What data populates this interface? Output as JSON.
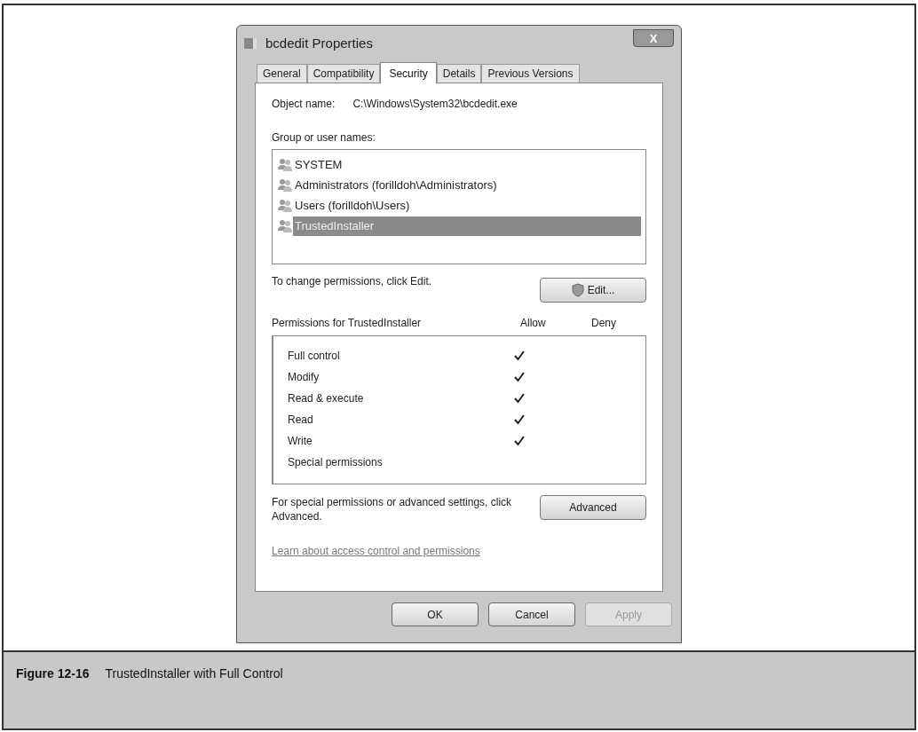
{
  "window": {
    "title": "bcdedit Properties",
    "close": "X"
  },
  "tabs": [
    {
      "label": "General",
      "selected": false
    },
    {
      "label": "Compatibility",
      "selected": false
    },
    {
      "label": "Security",
      "selected": true
    },
    {
      "label": "Details",
      "selected": false
    },
    {
      "label": "Previous Versions",
      "selected": false
    }
  ],
  "object_name": {
    "label": "Object name:",
    "value": "C:\\Windows\\System32\\bcdedit.exe"
  },
  "groups": {
    "label": "Group or user names:",
    "items": [
      {
        "name": "SYSTEM",
        "selected": false
      },
      {
        "name": "Administrators (forilldoh\\Administrators)",
        "selected": false
      },
      {
        "name": "Users (forilldoh\\Users)",
        "selected": false
      },
      {
        "name": "TrustedInstaller",
        "selected": true
      }
    ]
  },
  "change_hint": "To change permissions, click Edit.",
  "edit_button": "Edit...",
  "permissions": {
    "label": "Permissions for TrustedInstaller",
    "allow_header": "Allow",
    "deny_header": "Deny",
    "rows": [
      {
        "name": "Full control",
        "allow": true,
        "deny": false
      },
      {
        "name": "Modify",
        "allow": true,
        "deny": false
      },
      {
        "name": "Read & execute",
        "allow": true,
        "deny": false
      },
      {
        "name": "Read",
        "allow": true,
        "deny": false
      },
      {
        "name": "Write",
        "allow": true,
        "deny": false
      },
      {
        "name": "Special permissions",
        "allow": false,
        "deny": false
      }
    ]
  },
  "advanced_hint": "For special permissions or advanced settings, click Advanced.",
  "advanced_button": "Advanced",
  "learn_link": "Learn about access control and permissions",
  "buttons": [
    {
      "label": "OK",
      "disabled": false
    },
    {
      "label": "Cancel",
      "disabled": false
    },
    {
      "label": "Apply",
      "disabled": true
    }
  ],
  "caption": {
    "number": "Figure 12-16",
    "text": "TrustedInstaller with Full Control"
  }
}
